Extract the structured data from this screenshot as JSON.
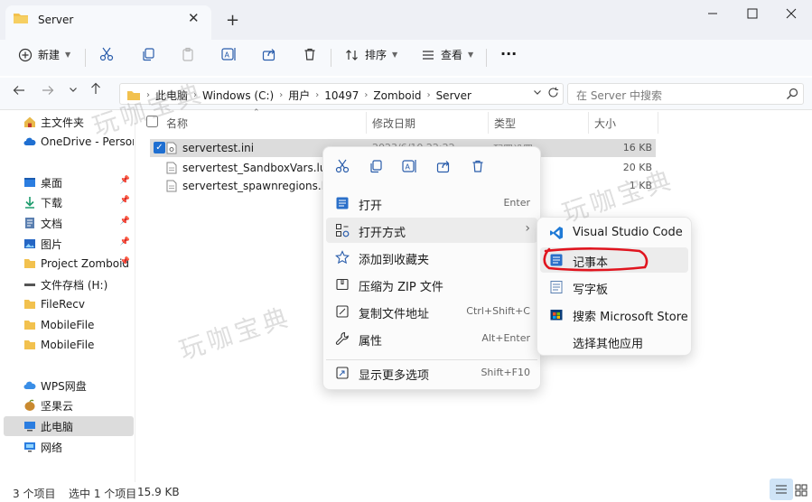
{
  "window": {
    "tab_title": "Server",
    "new_tab": "+",
    "close_tab": "✕"
  },
  "toolbar": {
    "new_label": "新建",
    "sort_label": "排序",
    "view_label": "查看",
    "more_label": "···"
  },
  "address": {
    "crumbs": [
      "此电脑",
      "Windows (C:)",
      "用户",
      "10497",
      "Zomboid",
      "Server"
    ],
    "search_placeholder": "在 Server 中搜索"
  },
  "sidebar": {
    "items": [
      {
        "label": "主文件夹",
        "icon": "home-icon"
      },
      {
        "label": "OneDrive - Persona",
        "icon": "cloud-icon"
      },
      {
        "label": "桌面",
        "icon": "desktop-icon",
        "pinned": true
      },
      {
        "label": "下载",
        "icon": "download-icon",
        "pinned": true
      },
      {
        "label": "文档",
        "icon": "document-icon",
        "pinned": true
      },
      {
        "label": "图片",
        "icon": "picture-icon",
        "pinned": true
      },
      {
        "label": "Project Zomboid",
        "icon": "folder-icon",
        "pinned": true
      },
      {
        "label": "文件存档 (H:)",
        "icon": "drive-icon"
      },
      {
        "label": "FileRecv",
        "icon": "folder-icon"
      },
      {
        "label": "MobileFile",
        "icon": "folder-icon"
      },
      {
        "label": "MobileFile",
        "icon": "folder-icon"
      },
      {
        "label": "WPS网盘",
        "icon": "cloud-icon"
      },
      {
        "label": "坚果云",
        "icon": "nut-icon"
      },
      {
        "label": "此电脑",
        "icon": "computer-icon"
      },
      {
        "label": "网络",
        "icon": "network-icon"
      }
    ]
  },
  "list": {
    "columns": [
      "名称",
      "修改日期",
      "类型",
      "大小"
    ],
    "rows": [
      {
        "name": "servertest.ini",
        "date": "2023/6/10 22:22",
        "type": "配置设置",
        "size": "16 KB",
        "selected": true
      },
      {
        "name": "servertest_SandboxVars.lua",
        "size": "20 KB"
      },
      {
        "name": "servertest_spawnregions.lua",
        "size": "1 KB"
      }
    ]
  },
  "context_menu": {
    "items": [
      {
        "label": "打开",
        "shortcut": "Enter"
      },
      {
        "label": "打开方式",
        "shortcut": "›"
      },
      {
        "label": "添加到收藏夹",
        "shortcut": ""
      },
      {
        "label": "压缩为 ZIP 文件",
        "shortcut": ""
      },
      {
        "label": "复制文件地址",
        "shortcut": "Ctrl+Shift+C"
      },
      {
        "label": "属性",
        "shortcut": "Alt+Enter"
      },
      {
        "label": "显示更多选项",
        "shortcut": "Shift+F10"
      }
    ]
  },
  "submenu": {
    "items": [
      {
        "label": "Visual Studio Code"
      },
      {
        "label": "记事本"
      },
      {
        "label": "写字板"
      },
      {
        "label": "搜索 Microsoft Store"
      },
      {
        "label": "选择其他应用"
      }
    ]
  },
  "status": {
    "count": "3 个项目",
    "selected": "选中 1 个项目",
    "size": "15.9 KB"
  },
  "watermark": {
    "text": "玩咖宝典"
  },
  "colors": {
    "accent": "#1f6fd1",
    "annotation": "#e0141e"
  }
}
